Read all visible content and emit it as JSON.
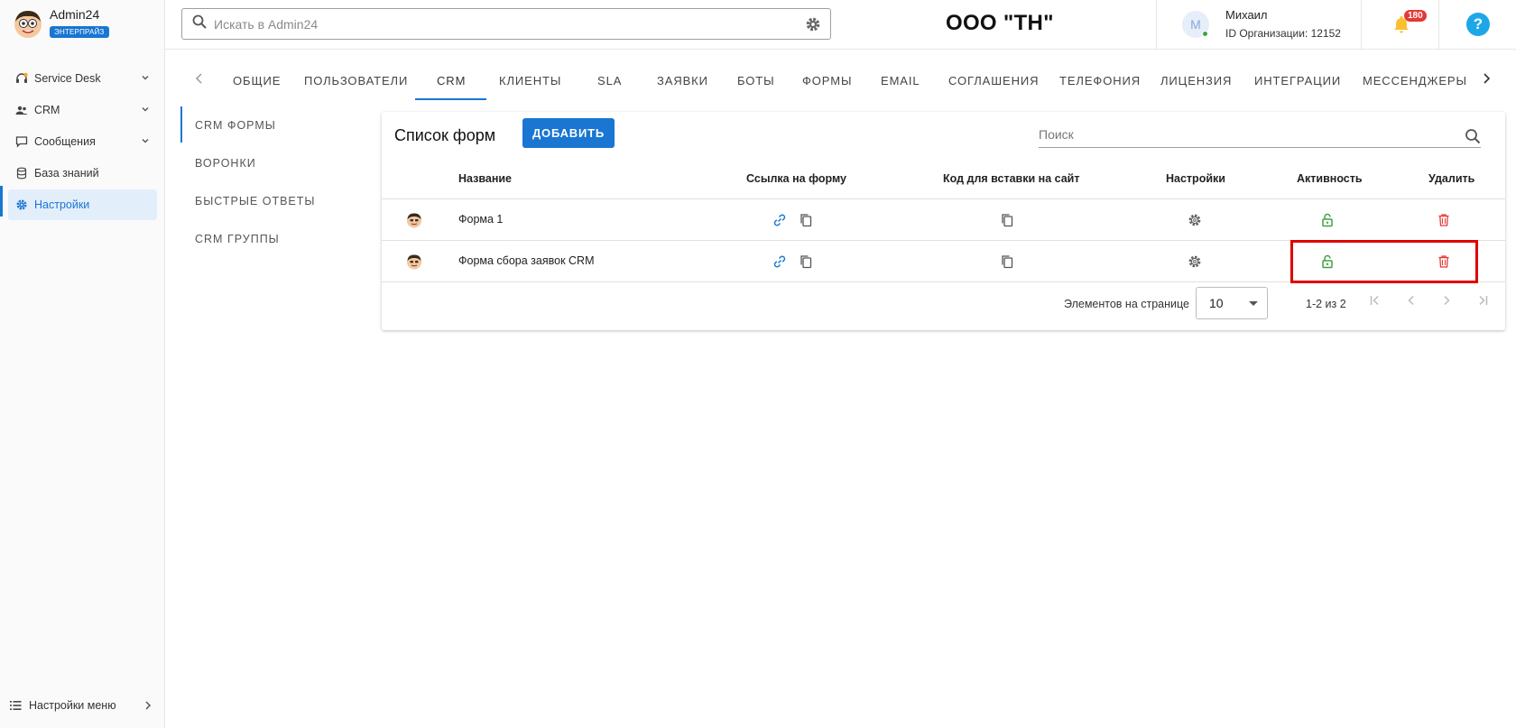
{
  "brand": {
    "name": "Admin24",
    "badge": "ЭНТЕРПРАЙЗ"
  },
  "sidebar": {
    "items": [
      {
        "label": "Service Desk",
        "icon": "headset-icon",
        "expandable": true
      },
      {
        "label": "CRM",
        "icon": "people-icon",
        "expandable": true
      },
      {
        "label": "Сообщения",
        "icon": "chat-icon",
        "expandable": true
      },
      {
        "label": "База знаний",
        "icon": "database-icon",
        "expandable": false
      },
      {
        "label": "Настройки",
        "icon": "gear-icon",
        "expandable": false,
        "active": true
      }
    ],
    "footer_label": "Настройки меню"
  },
  "header": {
    "search_placeholder": "Искать в Admin24",
    "org_title": "ООО \"ТН\"",
    "user": {
      "initial": "М",
      "name": "Михаил",
      "org_id": "ID Организации: 12152"
    },
    "notifications_count": "180",
    "help_glyph": "?"
  },
  "tabs": [
    "ОБЩИЕ",
    "ПОЛЬЗОВАТЕЛИ",
    "CRM",
    "КЛИЕНТЫ",
    "SLA",
    "ЗАЯВКИ",
    "БОТЫ",
    "ФОРМЫ",
    "EMAIL",
    "СОГЛАШЕНИЯ",
    "ТЕЛЕФОНИЯ",
    "ЛИЦЕНЗИЯ",
    "ИНТЕГРАЦИИ",
    "МЕССЕНДЖЕРЫ"
  ],
  "active_tab": "CRM",
  "subnav": {
    "items": [
      "CRM ФОРМЫ",
      "ВОРОНКИ",
      "БЫСТРЫЕ ОТВЕТЫ",
      "CRM ГРУППЫ"
    ],
    "active": "CRM ФОРМЫ"
  },
  "forms_card": {
    "title": "Список форм",
    "add_label": "ДОБАВИТЬ",
    "search_placeholder": "Поиск",
    "columns": [
      "Название",
      "Ссылка на форму",
      "Код для вставки на сайт",
      "Настройки",
      "Активность",
      "Удалить"
    ],
    "rows": [
      {
        "name": "Форма 1"
      },
      {
        "name": "Форма сбора заявок CRM"
      }
    ],
    "pagination": {
      "per_page_label": "Элементов на странице",
      "per_page_value": "10",
      "range": "1-2 из 2"
    }
  },
  "colors": {
    "accent": "#1976d2",
    "active_lock": "#43a047",
    "delete": "#e53935",
    "highlight": "#e00000"
  }
}
